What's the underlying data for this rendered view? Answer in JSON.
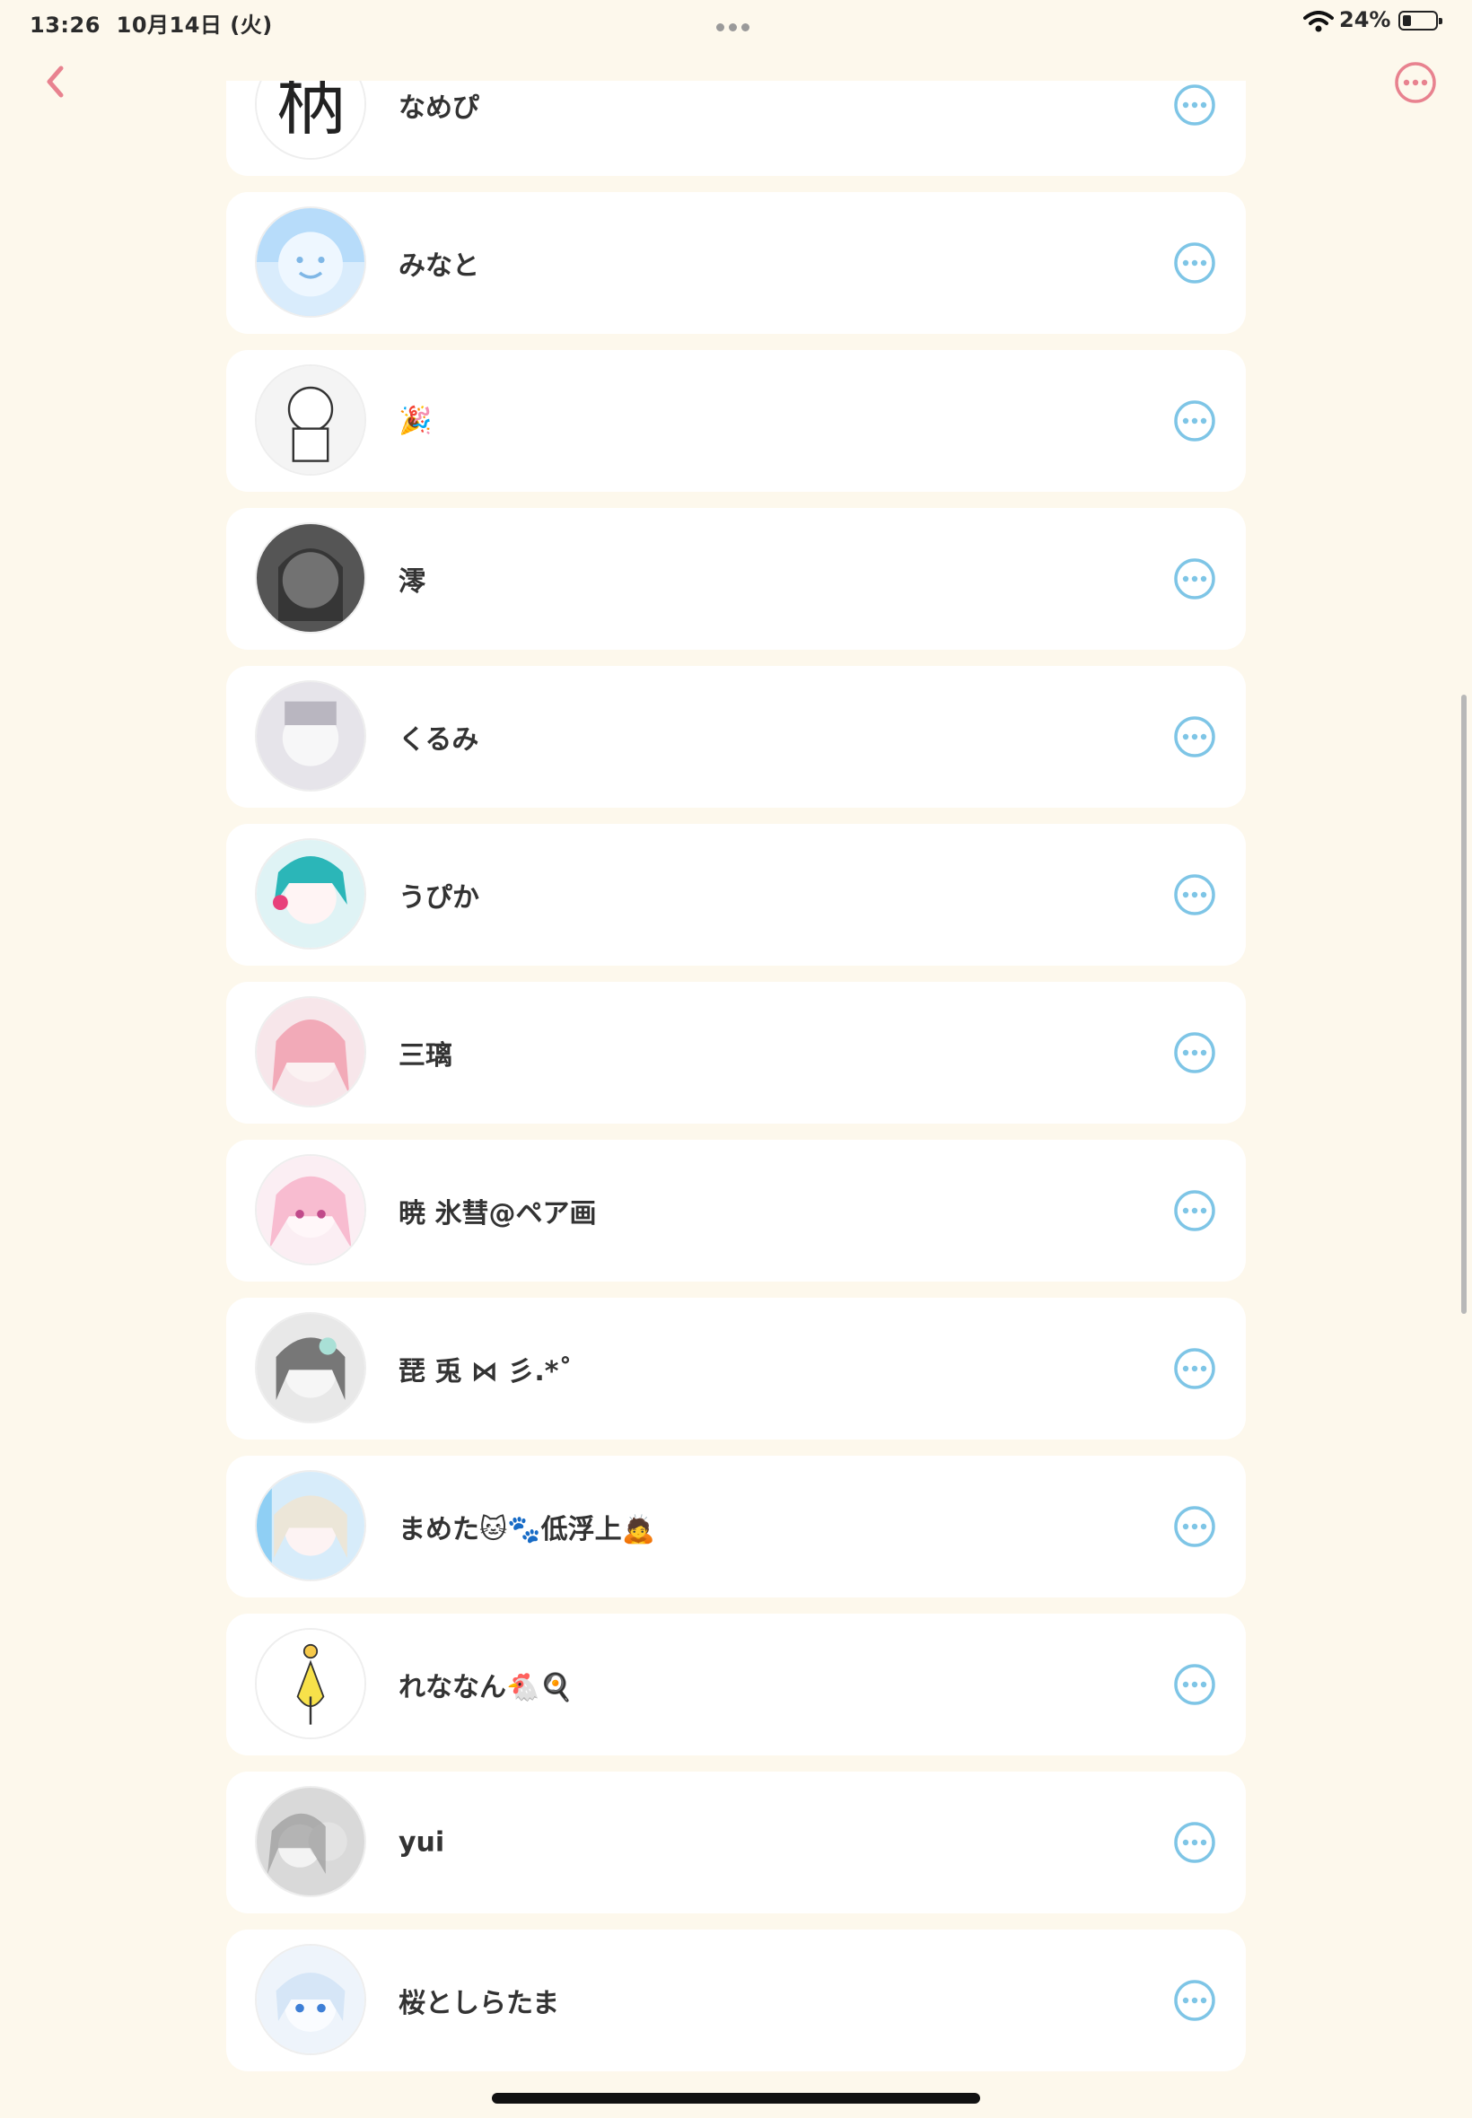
{
  "status_bar": {
    "time": "13:26",
    "date": "10月14日 (火)",
    "battery": "24%"
  },
  "nav": {
    "back_icon": "chevron-left-icon",
    "more_icon": "ellipsis-circle-icon"
  },
  "colors": {
    "accent_pink": "#e8828f",
    "row_more_blue": "#7ec5e6",
    "background": "#fdf8ec",
    "card": "#ffffff"
  },
  "users": [
    {
      "name": "なめぴ"
    },
    {
      "name": "みなと"
    },
    {
      "name": "🎉"
    },
    {
      "name": "澪"
    },
    {
      "name": "くるみ"
    },
    {
      "name": "うぴか"
    },
    {
      "name": "三璃"
    },
    {
      "name": "暁 氷彗@ペア画"
    },
    {
      "name": " 琵 兎 ⋈ 彡.*˚"
    },
    {
      "name": "まめた🐱🐾低浮上🙇"
    },
    {
      "name": "れななん🐔🍳"
    },
    {
      "name": "yui"
    },
    {
      "name": "桜としらたま"
    }
  ]
}
